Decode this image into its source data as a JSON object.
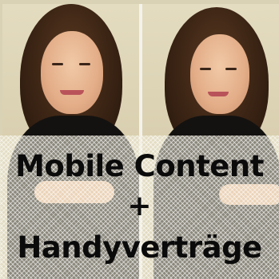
{
  "banner": {
    "headline_line1": "Mobile Content",
    "headline_plus": "+",
    "headline_line2": "Handyverträge"
  },
  "colors": {
    "text": "#0b0b0b",
    "background": "#d9d2b5",
    "overlay_pattern": "#ece9d6"
  }
}
